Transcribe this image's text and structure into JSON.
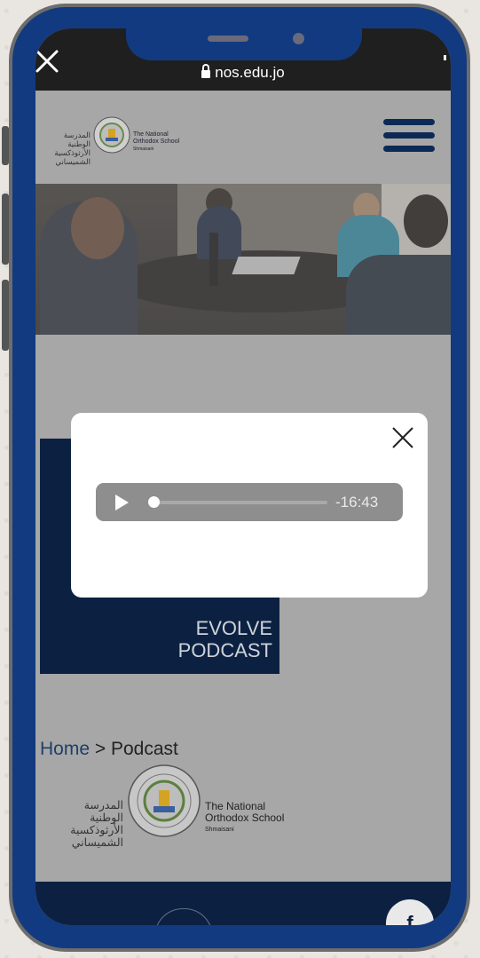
{
  "browser": {
    "url": "nos.edu.jo"
  },
  "header": {
    "logo": {
      "arabic": [
        "المدرسة",
        "الوطنية الأرثوذكسية",
        "الشميساني"
      ],
      "english": [
        "The National",
        "Orthodox School"
      ],
      "subtitle": "Shmaisani"
    }
  },
  "hero": {
    "image_description": ""
  },
  "banner": {
    "line1": "EVOLVE",
    "line2": "PODCAST"
  },
  "audio_player": {
    "remaining_time": "-16:43",
    "progress": 0.0
  },
  "breadcrumb": {
    "home": "Home",
    "separator": ">",
    "current": "Podcast"
  },
  "footer_logo": {
    "arabic": [
      "المدرسة",
      "الوطنية الأرثوذكسية",
      "الشميساني"
    ],
    "english": [
      "The National",
      "Orthodox School"
    ],
    "subtitle": "Shmaisani"
  },
  "footer": {
    "facebook_label": "f"
  },
  "colors": {
    "frame": "#123a80",
    "navy": "#0c2142",
    "overlay_page": "#a7a7a7",
    "player": "#8e8e8e"
  }
}
